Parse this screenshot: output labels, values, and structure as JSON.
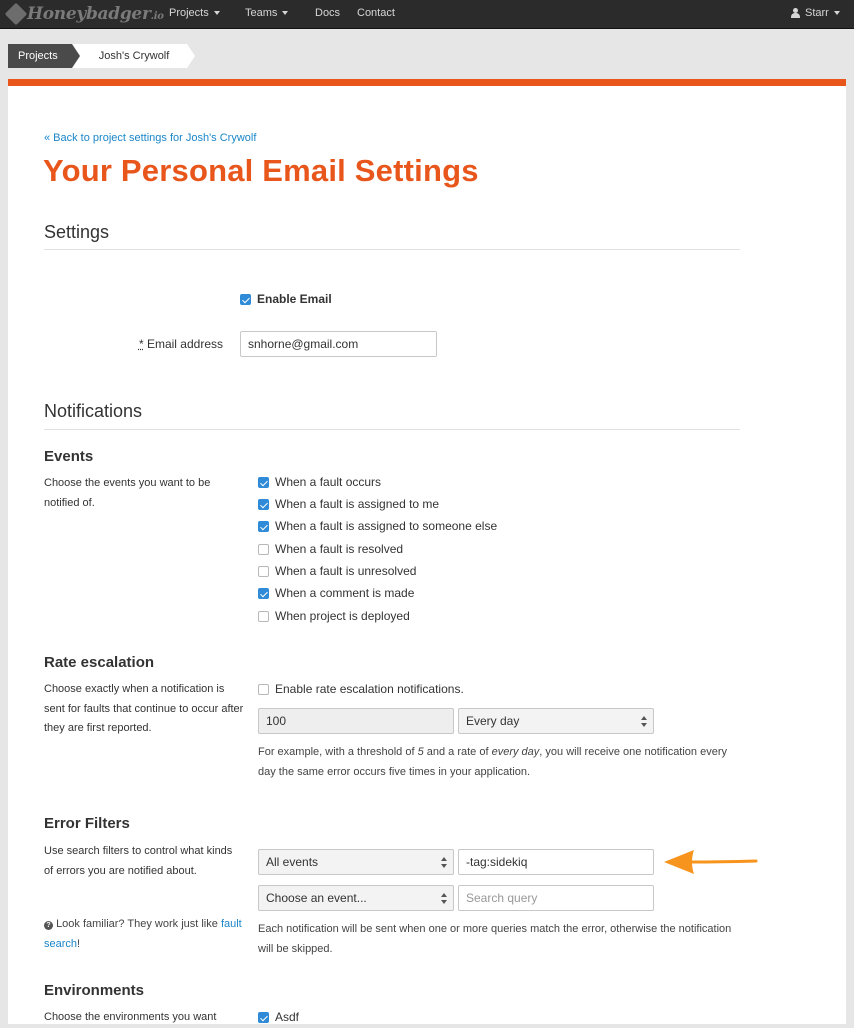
{
  "nav": {
    "logo_text": "Honeybadger",
    "logo_suffix": ".io",
    "projects": "Projects",
    "teams": "Teams",
    "docs": "Docs",
    "contact": "Contact",
    "user": "Starr"
  },
  "breadcrumb": [
    "Projects",
    "Josh's Crywolf"
  ],
  "back_link": "« Back to project settings for Josh's Crywolf",
  "title": "Your Personal Email Settings",
  "settings": {
    "heading": "Settings",
    "enable_email": "Enable Email",
    "enable_email_checked": true,
    "required_mark": "*",
    "email_label": "Email address",
    "email_value": "snhorne@gmail.com"
  },
  "notifications": {
    "heading": "Notifications",
    "events": {
      "heading": "Events",
      "description": "Choose the events you want to be notified of.",
      "options": [
        {
          "label": "When a fault occurs",
          "checked": true
        },
        {
          "label": "When a fault is assigned to me",
          "checked": true
        },
        {
          "label": "When a fault is assigned to someone else",
          "checked": true
        },
        {
          "label": "When a fault is resolved",
          "checked": false
        },
        {
          "label": "When a fault is unresolved",
          "checked": false
        },
        {
          "label": "When a comment is made",
          "checked": true
        },
        {
          "label": "When project is deployed",
          "checked": false
        }
      ]
    },
    "rate": {
      "heading": "Rate escalation",
      "description": "Choose exactly when a notification is sent for faults that continue to occur after they are first reported.",
      "enable_label": "Enable rate escalation notifications.",
      "enable_checked": false,
      "threshold": "100",
      "rate": "Every day",
      "help_1": "For example, with a threshold of ",
      "help_threshold": "5",
      "help_2": " and a rate of ",
      "help_rate": "every day",
      "help_3": ", you will receive one notification every day the same error occurs five times in your application."
    },
    "filters": {
      "heading": "Error Filters",
      "description": "Use search filters to control what kinds of errors you are notified about.",
      "familiar_text": "Look familiar? They work just like ",
      "familiar_link": "fault search",
      "familiar_end": "!",
      "rows": [
        {
          "event": "All events",
          "query": "-tag:sidekiq"
        },
        {
          "event": "Choose an event...",
          "query_placeholder": "Search query"
        }
      ],
      "help": "Each notification will be sent when one or more queries match the error, otherwise the notification will be skipped."
    },
    "environments": {
      "heading": "Environments",
      "description": "Choose the environments you want",
      "options": [
        {
          "label": "Asdf",
          "checked": true
        }
      ]
    }
  },
  "annotation": {
    "arrow_color": "#f7941d"
  }
}
